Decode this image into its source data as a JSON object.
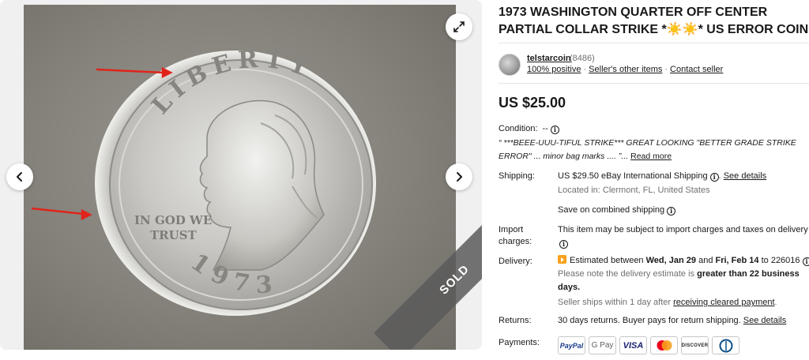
{
  "title": "1973 WASHINGTON QUARTER OFF CENTER PARTIAL COLLAR STRIKE *☀️☀️* US ERROR COIN",
  "gallery": {
    "sold_label": "SOLD",
    "coin_texts": {
      "liberty": "LIBERTY",
      "motto_line1": "IN GOD WE",
      "motto_line2": "TRUST",
      "year": "1973"
    },
    "colors": {
      "arrow": "#e0241b",
      "band": "#5a5a5a"
    },
    "icons": {
      "prev": "chevron-left-icon",
      "next": "chevron-right-icon",
      "expand": "expand-icon"
    }
  },
  "seller": {
    "name": "telstarcoin",
    "count": "(8486)",
    "positive": "100% positive",
    "other_items": "Seller's other items",
    "contact": "Contact seller"
  },
  "price": "US $25.00",
  "condition": {
    "label": "Condition:",
    "value": "--",
    "description": "“ ***BEEE-UUU-TIFUL STRIKE*** GREAT LOOKING \"BETTER GRADE STRIKE ERROR\" ... minor bag marks .... ”...",
    "read_more": "Read more"
  },
  "shipping": {
    "label": "Shipping:",
    "cost": "US $29.50",
    "method": "eBay International Shipping",
    "details_link": "See details",
    "location": "Located in: Clermont, FL, United States",
    "combined": "Save on combined shipping"
  },
  "import": {
    "label_line1": "Import",
    "label_line2": "charges:",
    "text": "This item may be subject to import charges and taxes on delivery"
  },
  "delivery": {
    "label": "Delivery:",
    "estimated_prefix": "Estimated between",
    "start": "Wed, Jan 29",
    "and": "and",
    "end": "Fri, Feb 14",
    "to": "to 226016",
    "note_prefix": "Please note the delivery estimate is",
    "note_bold": "greater than 22 business days.",
    "handling_prefix": "Seller ships within 1 day after",
    "handling_link": "receiving cleared payment",
    "handling_suffix": "."
  },
  "returns": {
    "label": "Returns:",
    "text": "30 days returns. Buyer pays for return shipping.",
    "details_link": "See details"
  },
  "payments": {
    "label": "Payments:",
    "methods": [
      "PayPal",
      "G Pay",
      "VISA",
      "Mastercard",
      "DISCOVER",
      "Diners Club"
    ]
  }
}
